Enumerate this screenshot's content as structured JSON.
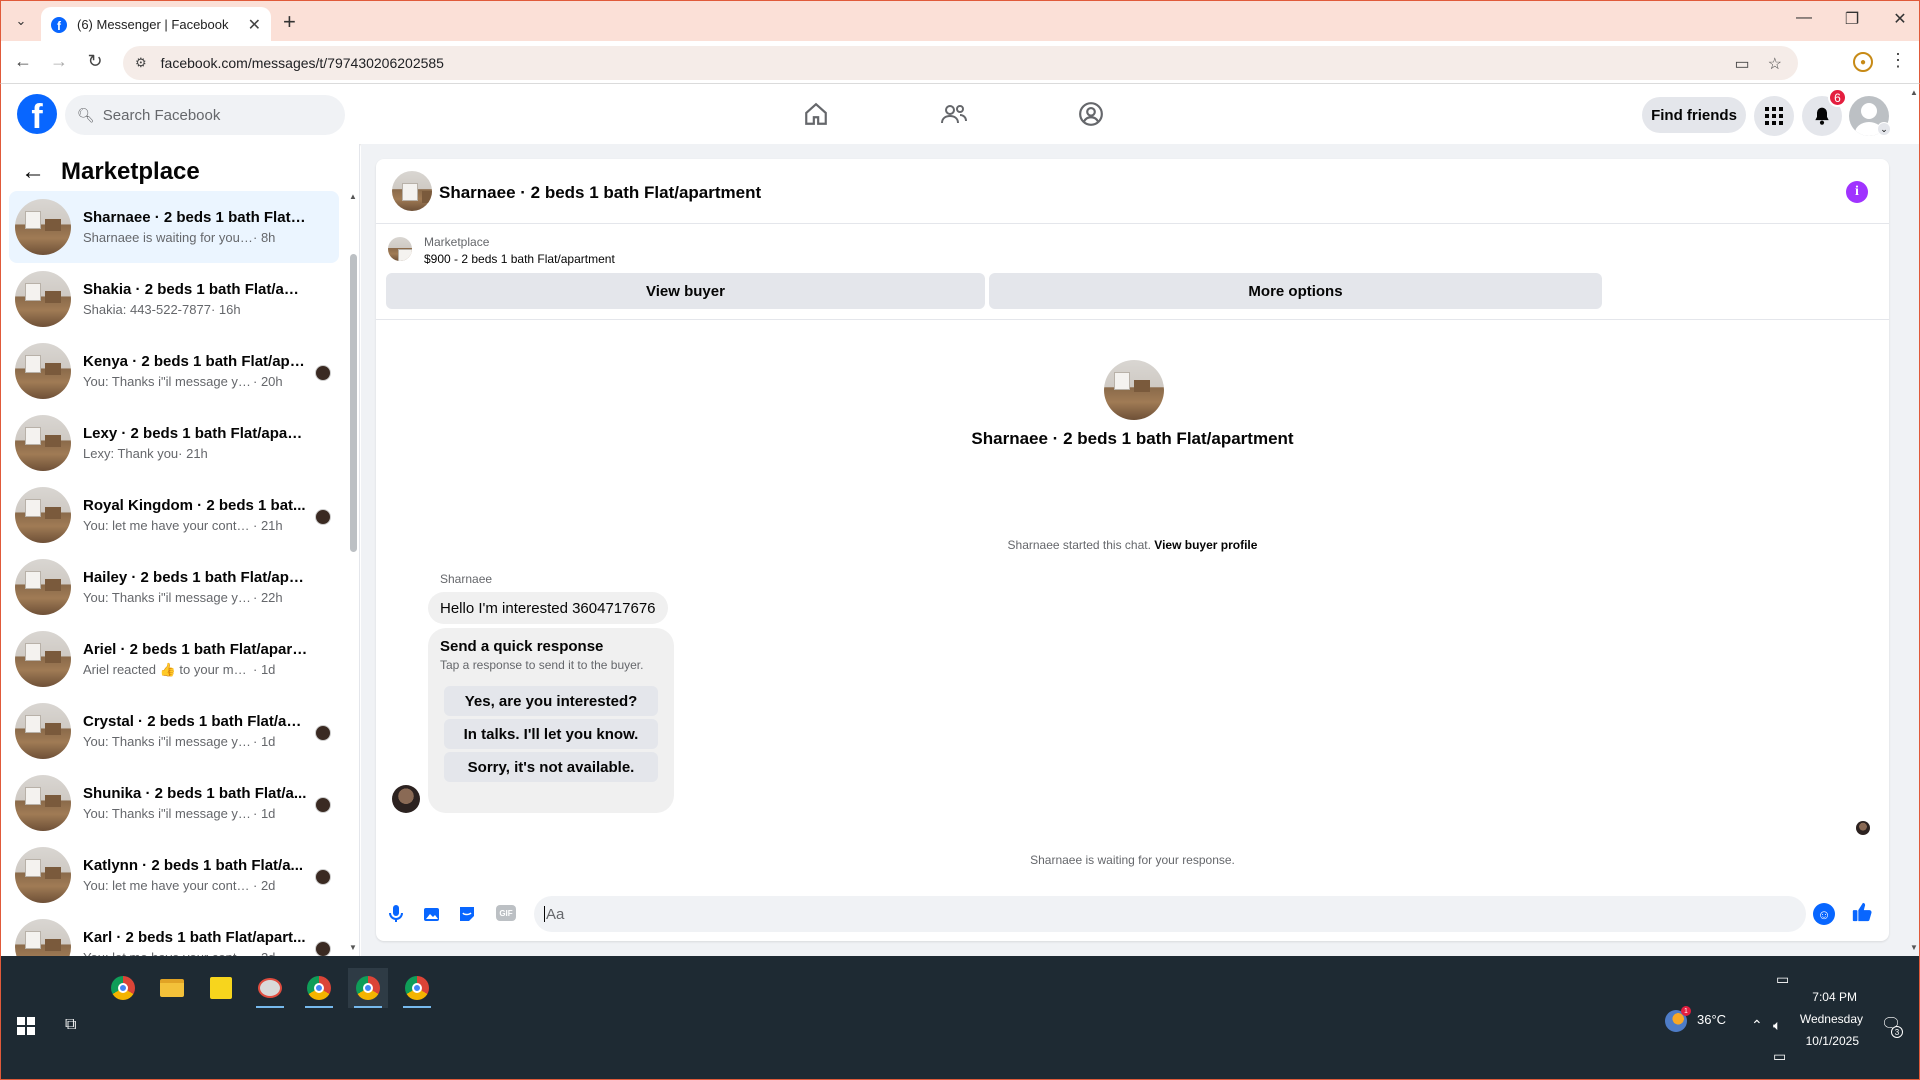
{
  "browser": {
    "tab_title": "(6) Messenger | Facebook",
    "url": "facebook.com/messages/t/797430206202585"
  },
  "fb": {
    "search_placeholder": "Search Facebook",
    "find_friends": "Find friends",
    "notification_count": "6"
  },
  "sidebar": {
    "title": "Marketplace",
    "conversations": [
      {
        "name": "Sharnaee · 2 beds 1 bath Flat/ap...",
        "snippet": "Sharnaee is waiting for your respo...",
        "time": "· 8h",
        "active": true,
        "seen": false
      },
      {
        "name": "Shakia · 2 beds 1 bath Flat/apart...",
        "snippet": "Shakia: 443-522-7877",
        "time": "· 16h",
        "active": false,
        "seen": false
      },
      {
        "name": "Kenya · 2 beds 1 bath Flat/apa...",
        "snippet": "You: Thanks i\"il message you in...",
        "time": "· 20h",
        "active": false,
        "seen": true
      },
      {
        "name": "Lexy · 2 beds 1 bath Flat/apartm...",
        "snippet": "Lexy: Thank you",
        "time": "· 21h",
        "active": false,
        "seen": false
      },
      {
        "name": "Royal Kingdom · 2 beds 1 bat...",
        "snippet": "You: let me have your contact n...",
        "time": "· 21h",
        "active": false,
        "seen": true
      },
      {
        "name": "Hailey · 2 beds 1 bath Flat/apart...",
        "snippet": "You: Thanks i\"il message you in a ...",
        "time": "· 22h",
        "active": false,
        "seen": false
      },
      {
        "name": "Ariel · 2 beds 1 bath Flat/apartm...",
        "snippet": "Ariel reacted 👍 to your message",
        "time": "· 1d",
        "active": false,
        "seen": false
      },
      {
        "name": "Crystal · 2 beds 1 bath Flat/ap...",
        "snippet": "You: Thanks i\"il message you in ...",
        "time": "· 1d",
        "active": false,
        "seen": true
      },
      {
        "name": "Shunika · 2 beds 1 bath Flat/a...",
        "snippet": "You: Thanks i\"il message you in ...",
        "time": "· 1d",
        "active": false,
        "seen": true
      },
      {
        "name": "Katlynn · 2 beds 1 bath Flat/a...",
        "snippet": "You: let me have your contact n...",
        "time": "· 2d",
        "active": false,
        "seen": true
      },
      {
        "name": "Karl · 2 beds 1 bath Flat/apart...",
        "snippet": "You: let me have your contact n...",
        "time": "· 2d",
        "active": false,
        "seen": true
      }
    ]
  },
  "chat": {
    "title": "Sharnaee · 2 beds 1 bath Flat/apartment",
    "marketplace_label": "Marketplace",
    "listing": "$900 - 2 beds 1 bath Flat/apartment",
    "view_buyer": "View buyer",
    "more_options": "More options",
    "center_name": "Sharnaee · 2 beds 1 bath Flat/apartment",
    "started_text": "Sharnaee started this chat.",
    "view_buyer_profile": "View buyer profile",
    "sender": "Sharnaee",
    "message": "Hello I'm interested 3604717676",
    "quick_title": "Send a quick response",
    "quick_sub": "Tap a response to send it to the buyer.",
    "quick_replies": [
      "Yes, are you interested?",
      "In talks. I'll let you know.",
      "Sorry, it's not available."
    ],
    "waiting": "Sharnaee is waiting for your response.",
    "composer_placeholder": "Aa"
  },
  "taskbar": {
    "temperature": "36°C",
    "time": "7:04 PM",
    "day": "Wednesday",
    "date": "10/1/2025",
    "notification_count": "3",
    "weather_badge": "1"
  },
  "colors": {
    "fb_blue": "#0866ff",
    "active_row": "#ebf5ff",
    "info_purple": "#a033ff",
    "badge_red": "#e41e3f",
    "taskbar": "#1e2a33"
  }
}
